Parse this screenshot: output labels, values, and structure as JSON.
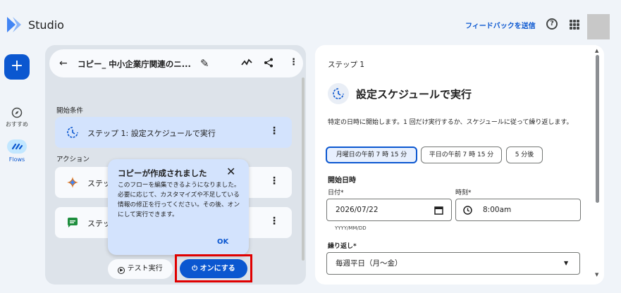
{
  "app": {
    "title": "Studio"
  },
  "topbar": {
    "feedback_label": "フィードバックを送信",
    "help_glyph": "?"
  },
  "rail": {
    "add_glyph": "+",
    "items": [
      {
        "label": "おすすめ",
        "icon": "compass-icon"
      },
      {
        "label": "Flows",
        "icon": "flows-icon",
        "active": true
      }
    ]
  },
  "flow": {
    "back_glyph": "←",
    "name": "コピー_ 中小企業庁関連のニ...",
    "edit_glyph": "✎",
    "start_section": "開始条件",
    "action_section": "アクション",
    "steps": [
      {
        "label": "ステップ 1: 設定スケジュールで実行",
        "icon": "schedule-icon"
      },
      {
        "label": "ステッ",
        "icon": "gemini-sparkle-icon"
      },
      {
        "label": "ステッ",
        "icon": "chat-icon"
      }
    ],
    "test_label": "テスト実行",
    "on_label": "オンにする"
  },
  "tooltip": {
    "title": "コピーが作成されました",
    "body": "このフローを編集できるようになりました。必要に応じて、カスタマイズや不足している情報の修正を行ってください。その後、オンにして実行できます。",
    "ok_label": "OK",
    "close_glyph": "✕"
  },
  "detail": {
    "step_label": "ステップ 1",
    "title": "設定スケジュールで実行",
    "description": "特定の日時に開始します。1 回だけ実行するか、スケジュールに従って繰り返します。",
    "chips": [
      "月曜日の午前 7 時 15 分",
      "平日の午前 7 時 15 分",
      "5 分後"
    ],
    "start_heading": "開始日時",
    "date_label": "日付*",
    "date_value": "2026/07/22",
    "date_helper": "YYYY/MM/DD",
    "time_label": "時刻*",
    "time_value": "8:00am",
    "repeat_label": "繰り返し*",
    "repeat_value": "毎週平日（月〜金）"
  },
  "colors": {
    "accent": "#0b57d0",
    "highlight": "#e00000",
    "selected_step": "#d3e3fd"
  }
}
